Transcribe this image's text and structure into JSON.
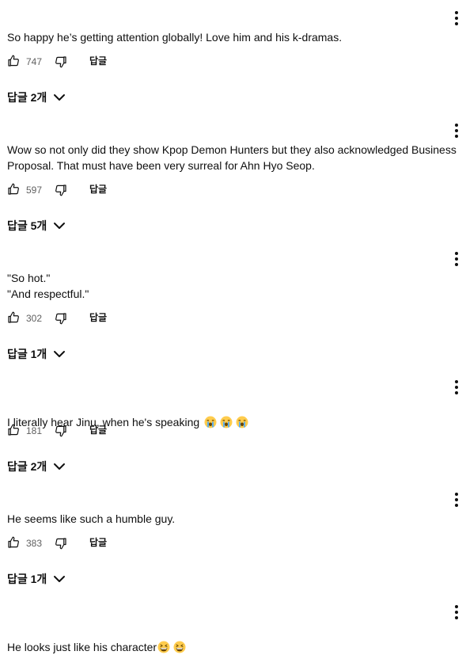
{
  "comments": [
    {
      "text": "So happy he’s getting attention globally! Love him and his k-dramas.",
      "likes": "747",
      "reply_label": "답글",
      "replies_label": "답글 2개"
    },
    {
      "text": "Wow so not only did they show Kpop Demon Hunters but they also acknowledged Business Proposal. That must have been very surreal for Ahn Hyo Seop.",
      "likes": "597",
      "reply_label": "답글",
      "replies_label": "답글 5개"
    },
    {
      "text": "\"So hot.\"\n\"And respectful.\"",
      "likes": "302",
      "reply_label": "답글",
      "replies_label": "답글 1개"
    },
    {
      "text": "I literally hear Jinu, when he's speaking",
      "emojis": [
        "loudly-crying-face",
        "loudly-crying-face",
        "loudly-crying-face"
      ],
      "likes": "181",
      "reply_label": "답글",
      "replies_label": "답글 2개"
    },
    {
      "text": "He seems like such a humble guy.",
      "likes": "383",
      "reply_label": "답글",
      "replies_label": "답글 1개"
    },
    {
      "text": "He looks just  like his character",
      "emojis": [
        "grinning-squinting-face",
        "grinning-squinting-face"
      ]
    }
  ],
  "colors": {
    "text": "#0f0f0f",
    "secondary": "#606060",
    "emoji_face": "#ffcc4d",
    "emoji_tear": "#5dadec"
  }
}
